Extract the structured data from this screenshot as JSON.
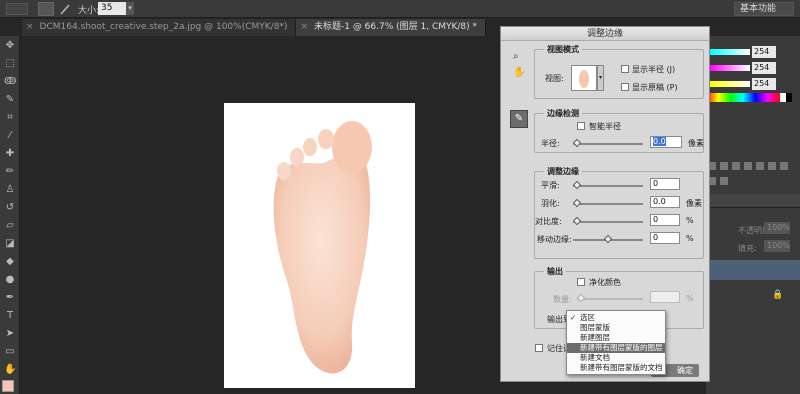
{
  "options_bar": {
    "size_label": "大小:",
    "size_value": "35",
    "workspace": "基本功能"
  },
  "tabs": [
    {
      "label": "DCM164.shoot_creative.step_2a.jpg @ 100%(CMYK/8*)",
      "active": false
    },
    {
      "label": "未标题-1 @ 66.7% (图层 1, CMYK/8) *",
      "active": true
    }
  ],
  "color_panel": {
    "values": [
      "254",
      "254",
      "254"
    ]
  },
  "layers_panel": {
    "opacity_label": "不透明度:",
    "opacity_value": "100%",
    "fill_label": "填充:",
    "fill_value": "100%"
  },
  "dialog": {
    "title": "调整边缘",
    "view_mode": {
      "title": "视图模式",
      "view_label": "视图:",
      "show_radius": "显示半径 (J)",
      "show_original": "显示原稿 (P)"
    },
    "edge_detection": {
      "title": "边缘检测",
      "smart_radius": "智能半径",
      "radius_label": "半径:",
      "radius_value": "0.0",
      "radius_unit": "像素"
    },
    "adjust_edge": {
      "title": "调整边缘",
      "smooth_label": "平滑:",
      "smooth_value": "0",
      "feather_label": "羽化:",
      "feather_value": "0.0",
      "feather_unit": "像素",
      "contrast_label": "对比度:",
      "contrast_value": "0",
      "contrast_unit": "%",
      "shift_label": "移动边缘:",
      "shift_value": "0",
      "shift_unit": "%"
    },
    "output": {
      "title": "输出",
      "decontaminate": "净化颜色",
      "amount_label": "数量:",
      "amount_unit": "%",
      "output_to_label": "输出到:",
      "remember_label": "记住设"
    },
    "ok_label": "确定"
  },
  "output_menu": {
    "items": [
      {
        "label": "选区",
        "checked": true,
        "highlighted": false
      },
      {
        "label": "图层蒙版",
        "checked": false,
        "highlighted": false
      },
      {
        "label": "新建图层",
        "checked": false,
        "highlighted": false
      },
      {
        "label": "新建带有图层蒙版的图层",
        "checked": false,
        "highlighted": true
      },
      {
        "label": "新建文档",
        "checked": false,
        "highlighted": false
      },
      {
        "label": "新建带有图层蒙版的文档",
        "checked": false,
        "highlighted": false
      }
    ]
  },
  "colors": {
    "foreground": "#f2c5b5",
    "selection": "#6c6c6c"
  }
}
